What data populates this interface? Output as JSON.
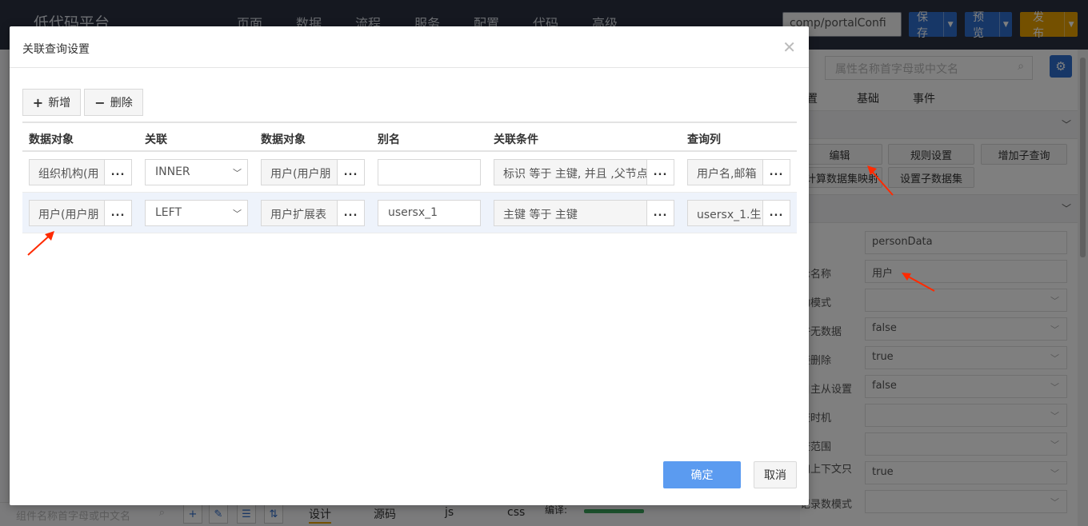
{
  "topbar": {
    "logo": "低代码平台",
    "nav": [
      "页面",
      "数据",
      "流程",
      "服务",
      "配置",
      "代码",
      "高级"
    ],
    "path": "comp/portalConfi",
    "save": "保存",
    "preview": "预览",
    "publish": "发布"
  },
  "right_panel": {
    "search_placeholder": "属性名称首字母或中文名",
    "tabs": [
      "置",
      "基础",
      "事件"
    ],
    "sections": [
      "",
      ""
    ],
    "buttons": {
      "edit": "编辑",
      "rules": "规则设置",
      "add_subquery": "增加子查询",
      "calc_mapping": "计算数据集映射",
      "set_sub_dataset": "设置子数据集"
    },
    "fields": [
      {
        "label": "",
        "value": "personData",
        "dropdown": false
      },
      {
        "label": "示名称",
        "value": "用户",
        "dropdown": false
      },
      {
        "label": "动模式",
        "value": "",
        "dropdown": true
      },
      {
        "label": "许无数据",
        "value": "false",
        "dropdown": true
      },
      {
        "label": "接删除",
        "value": "true",
        "dropdown": true
      },
      {
        "label": "自主从设置",
        "value": "false",
        "dropdown": true
      },
      {
        "label": "查时机",
        "value": "",
        "dropdown": true
      },
      {
        "label": "查范围",
        "value": "",
        "dropdown": true
      },
      {
        "label": "加上下文只",
        "value": "true",
        "dropdown": true
      },
      {
        "label": "记录数模式",
        "value": "",
        "dropdown": true
      }
    ]
  },
  "bottom_bar": {
    "search_placeholder": "组件名称首字母或中文名",
    "tabs": [
      "设计",
      "源码",
      "js",
      "css"
    ],
    "compile_label": "编译:"
  },
  "dialog": {
    "title": "关联查询设置",
    "add_button": "新增",
    "delete_button": "删除",
    "columns": [
      "数据对象",
      "关联",
      "数据对象",
      "别名",
      "关联条件",
      "查询列"
    ],
    "rows": [
      {
        "object": "组织机构(用",
        "join": "INNER",
        "target": "用户(用户朋",
        "alias": "",
        "condition": "标识 等于 主键, 并且 ,父节点",
        "columns": "用户名,邮箱"
      },
      {
        "object": "用户(用户朋",
        "join": "LEFT",
        "target": "用户扩展表",
        "alias": "usersx_1",
        "condition": "主键 等于 主键",
        "columns": "usersx_1.生"
      }
    ],
    "ok": "确定",
    "cancel": "取消"
  },
  "colors": {
    "primary": "#2f6fcf",
    "publish": "#e8a100",
    "ok_button": "#5b9bf0",
    "annotation": "#ff2a00"
  }
}
